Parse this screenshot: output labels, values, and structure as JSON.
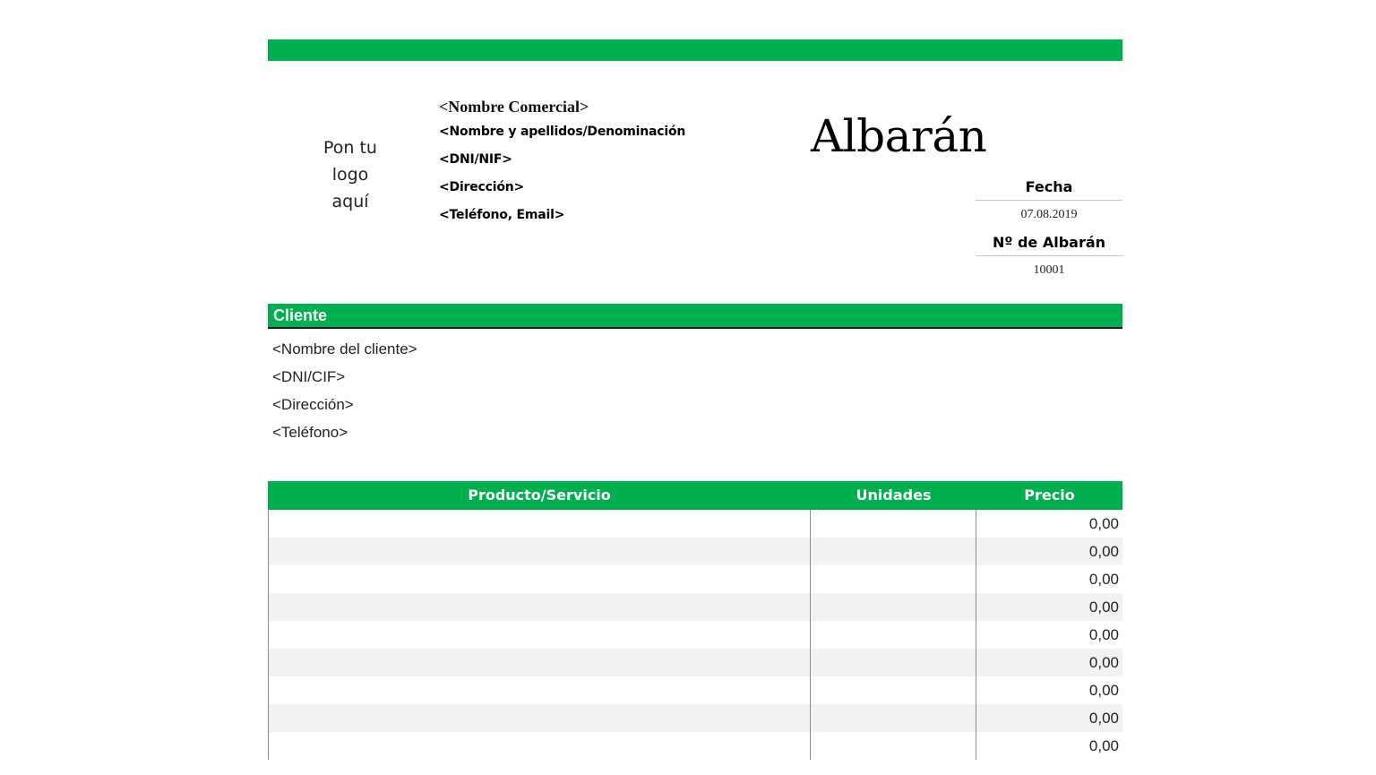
{
  "logo_placeholder": [
    "Pon tu",
    "logo",
    "aquí"
  ],
  "company": {
    "name": "<Nombre Comercial>",
    "lines": [
      "<Nombre y apellidos/Denominación",
      "<DNI/NIF>",
      "<Dirección>",
      "<Teléfono, Email>"
    ]
  },
  "document": {
    "title": "Albarán",
    "date_label": "Fecha",
    "date_value": "07.08.2019",
    "number_label": "Nº de Albarán",
    "number_value": "10001"
  },
  "client": {
    "header": "Cliente",
    "lines": [
      "<Nombre del cliente>",
      "<DNI/CIF>",
      "<Dirección>",
      "<Teléfono>"
    ]
  },
  "items": {
    "columns": [
      "Producto/Servicio",
      "Unidades",
      "Precio"
    ],
    "rows": [
      {
        "price": "0,00"
      },
      {
        "price": "0,00"
      },
      {
        "price": "0,00"
      },
      {
        "price": "0,00"
      },
      {
        "price": "0,00"
      },
      {
        "price": "0,00"
      },
      {
        "price": "0,00"
      },
      {
        "price": "0,00"
      },
      {
        "price": "0,00"
      }
    ]
  },
  "colors": {
    "accent": "#00b050"
  }
}
